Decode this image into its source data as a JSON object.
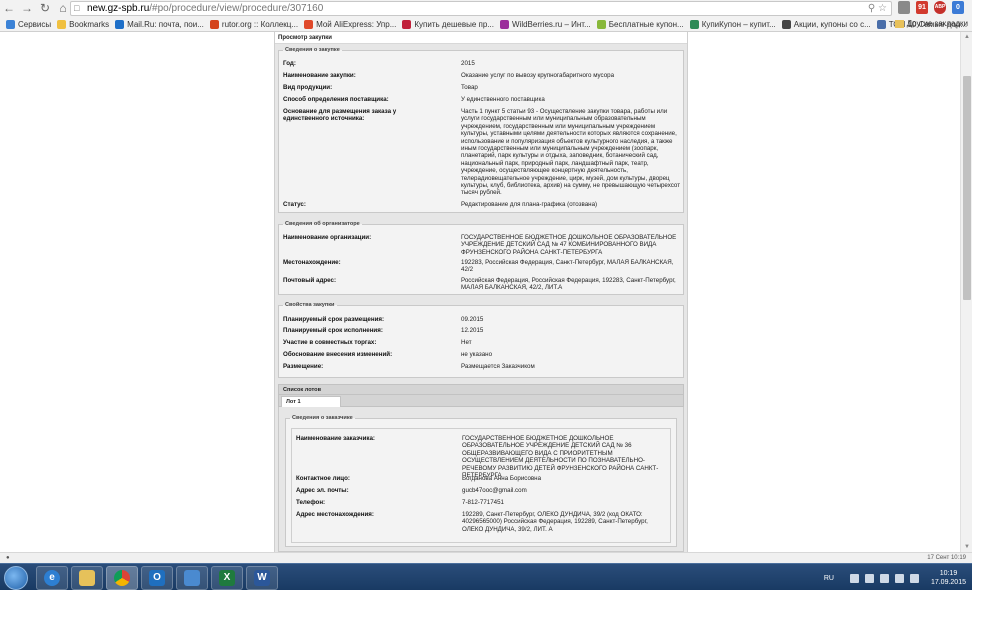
{
  "browser": {
    "url_domain": "new.gz-spb.ru",
    "url_path": "/#po/procedure/view/procedure/307160",
    "extension_badge": "91",
    "extension_abp": "ABP",
    "extension_badge2": "0",
    "bookmarks": [
      {
        "label": "Сервисы",
        "color": "#3b82d6"
      },
      {
        "label": "Bookmarks",
        "color": "#f0c040"
      },
      {
        "label": "Mail.Ru: почта, пои...",
        "color": "#1e6fc8"
      },
      {
        "label": "rutor.org :: Коллекц...",
        "color": "#d4441c"
      },
      {
        "label": "Мой AliExpress: Упр...",
        "color": "#e0492a"
      },
      {
        "label": "Купить дешевые пр...",
        "color": "#c0203a"
      },
      {
        "label": "WildBerries.ru – Инт...",
        "color": "#9b2d9b"
      },
      {
        "label": "Бесплатные купон...",
        "color": "#88b83a"
      },
      {
        "label": "КупиКупон – купит...",
        "color": "#2e8b57"
      },
      {
        "label": "Акции, купоны со с...",
        "color": "#444444"
      },
      {
        "label": "ТОП 10 Самые дор...",
        "color": "#4a6ea9"
      }
    ],
    "bookmarks_other": "Другие закладки"
  },
  "page": {
    "header": "Просмотр закупки",
    "purchase_info": {
      "legend": "Сведения о закупке",
      "rows": [
        {
          "label": "Год:",
          "value": "2015"
        },
        {
          "label": "Наименование закупки:",
          "value": "Оказание услуг по вывозу крупногабаритного мусора"
        },
        {
          "label": "Вид продукции:",
          "value": "Товар"
        },
        {
          "label": "Способ определения поставщика:",
          "value": "У единственного поставщика"
        },
        {
          "label": "Основание для размещения заказа у единственного источника:",
          "value": "Часть 1 пункт 5 статьи 93 - Осуществление закупки товара, работы или услуги государственным или муниципальным образовательным учреждением, государственным или муниципальным учреждением культуры, уставными целями деятельности которых являются сохранение, использование и популяризация объектов культурного наследия, а также иным государственным или муниципальным учреждением (зоопарк, планетарий, парк культуры и отдыха, заповедник, ботанический сад, национальный парк, природный парк, ландшафтный парк, театр, учреждение, осуществляющее концертную деятельность, телерадиовещательное учреждение, цирк, музей, дом культуры, дворец культуры, клуб, библиотека, архив) на сумму, не превышающую четырехсот тысяч рублей."
        },
        {
          "label": "Статус:",
          "value": "Редактирование для плана-графика (отозвана)"
        }
      ]
    },
    "organizer_info": {
      "legend": "Сведения об организаторе",
      "rows": [
        {
          "label": "Наименование организации:",
          "value": "ГОСУДАРСТВЕННОЕ БЮДЖЕТНОЕ ДОШКОЛЬНОЕ ОБРАЗОВАТЕЛЬНОЕ УЧРЕЖДЕНИЕ ДЕТСКИЙ САД № 47 КОМБИНИРОВАННОГО ВИДА ФРУНЗЕНСКОГО РАЙОНА САНКТ-ПЕТЕРБУРГА"
        },
        {
          "label": "Местонахождение:",
          "value": "192283, Российская Федерация, Санкт-Петербург, МАЛАЯ БАЛКАНСКАЯ, 42/2"
        },
        {
          "label": "Почтовый адрес:",
          "value": "Российская Федерация, Российская Федерация, 192283, Санкт-Петербург, МАЛАЯ БАЛКАНСКАЯ, 42/2, ЛИТ.А"
        }
      ]
    },
    "purchase_props": {
      "legend": "Свойства закупки",
      "rows": [
        {
          "label": "Планируемый срок размещения:",
          "value": "09.2015"
        },
        {
          "label": "Планируемый срок исполнения:",
          "value": "12.2015"
        },
        {
          "label": "Участие в совместных торгах:",
          "value": "Нет"
        },
        {
          "label": "Обоснование внесения изменений:",
          "value": "не указано"
        },
        {
          "label": "Размещение:",
          "value": "Размещается Заказчиком"
        }
      ]
    },
    "lots": {
      "title": "Список лотов",
      "tab": "Лот 1",
      "customer": {
        "legend": "Сведения о заказчике",
        "rows": [
          {
            "label": "Наименование заказчика:",
            "value": "ГОСУДАРСТВЕННОЕ БЮДЖЕТНОЕ ДОШКОЛЬНОЕ ОБРАЗОВАТЕЛЬНОЕ УЧРЕЖДЕНИЕ ДЕТСКИЙ САД № 36 ОБЩЕРАЗВИВАЮЩЕГО ВИДА С ПРИОРИТЕТНЫМ ОСУЩЕСТВЛЕНИЕМ ДЕЯТЕЛЬНОСТИ ПО ПОЗНАВАТЕЛЬНО-РЕЧЕВОМУ РАЗВИТИЮ ДЕТЕЙ ФРУНЗЕНСКОГО РАЙОНА САНКТ-ПЕТЕРБУРГА"
          },
          {
            "label": "Контактное лицо:",
            "value": "Богданова Анна Борисовна"
          },
          {
            "label": "Адрес эл. почты:",
            "value": "gucb47ooc@gmail.com"
          },
          {
            "label": "Телефон:",
            "value": "7-812-7717451"
          },
          {
            "label": "Адрес местонахождения:",
            "value": "192289, Санкт-Петербург, ОЛЕКО ДУНДИЧА, 39/2 (код ОКАТО: 40296565000) Российская Федерация, 192289, Санкт-Петербург, ОЛЕКО ДУНДИЧА, 39/2, ЛИТ. А"
          }
        ]
      }
    }
  },
  "status_bar": {
    "timestamp": "17 Сент 10:19"
  },
  "taskbar": {
    "language": "RU",
    "time": "10:19",
    "date": "17.09.2015"
  }
}
